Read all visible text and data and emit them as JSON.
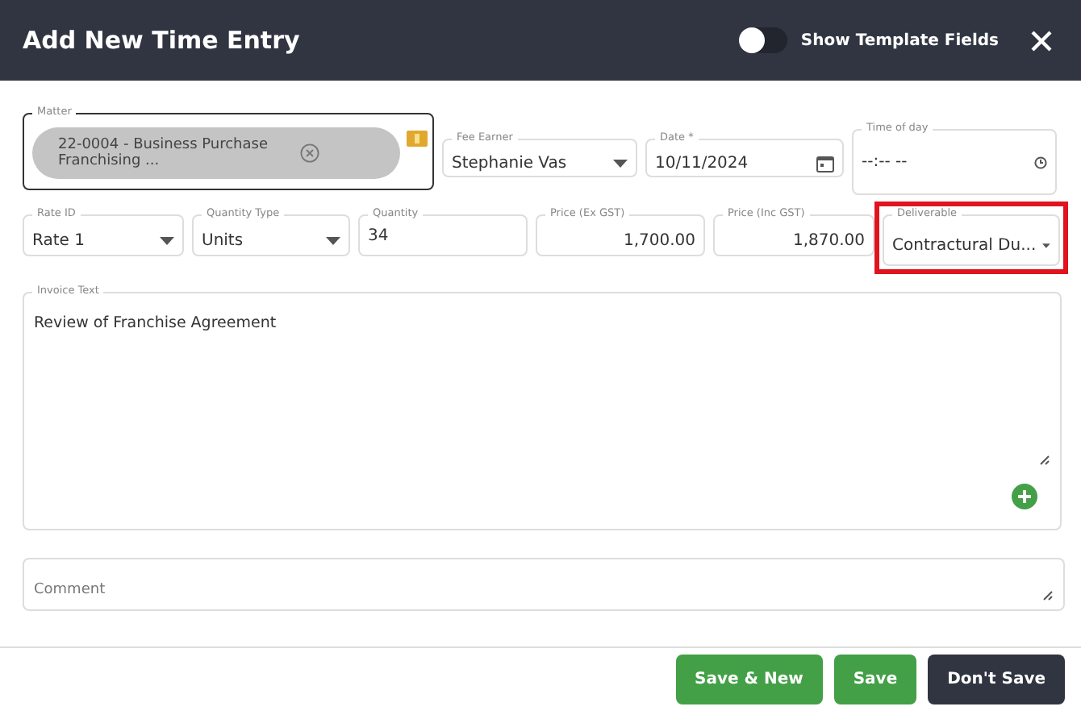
{
  "title": "Add New Time Entry",
  "template_toggle": {
    "label": "Show Template Fields",
    "on": false
  },
  "row_1": [
    {
      "kind": "chip",
      "label": "Matter",
      "value": "22-0004 - Business Purchase Franchising ...",
      "focused": true,
      "highlighted": false
    },
    {
      "kind": "select",
      "label": "Fee Earner",
      "value": "Stephanie Vas",
      "focused": false,
      "highlighted": false
    },
    {
      "kind": "date",
      "label": "Date *",
      "value": "10/11/2024",
      "focused": false,
      "highlighted": false
    },
    {
      "kind": "time",
      "label": "Time of day",
      "value": "--:-- --",
      "focused": false,
      "highlighted": false
    }
  ],
  "row_2": [
    {
      "kind": "select",
      "label": "Rate ID",
      "value": "Rate 1",
      "focused": false,
      "highlighted": false
    },
    {
      "kind": "select",
      "label": "Quantity Type",
      "value": "Units",
      "focused": false,
      "highlighted": false
    },
    {
      "kind": "text",
      "label": "Quantity",
      "value": "34",
      "focused": false,
      "highlighted": false
    },
    {
      "kind": "number",
      "label": "Price (Ex GST)",
      "value": "1,700.00",
      "focused": false,
      "highlighted": false
    },
    {
      "kind": "number",
      "label": "Price (Inc GST)",
      "value": "1,870.00",
      "focused": false,
      "highlighted": false
    },
    {
      "kind": "select",
      "label": "Deliverable",
      "value": "Contractural Du...",
      "focused": false,
      "highlighted": true
    }
  ],
  "invoice_text": {
    "label": "Invoice Text",
    "value": "Review of Franchise Agreement"
  },
  "comment": {
    "placeholder": "Comment"
  },
  "buttons": [
    {
      "label": "Save & New",
      "kind": "primary"
    },
    {
      "label": "Save",
      "kind": "primary"
    },
    {
      "label": "Don't Save",
      "kind": "dark"
    }
  ]
}
